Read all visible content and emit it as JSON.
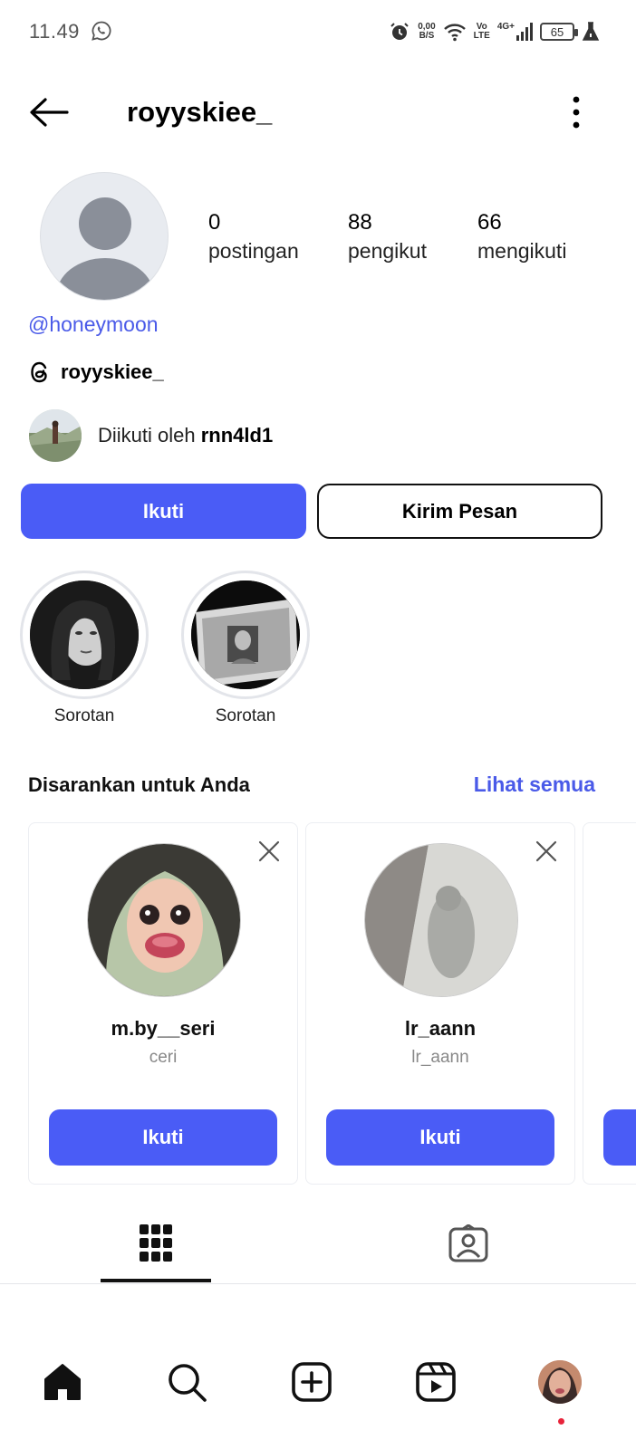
{
  "status_bar": {
    "time": "11.49",
    "net_speed_top": "0,00",
    "net_speed_bottom": "B/S",
    "volte_top": "Vo",
    "volte_bottom": "LTE",
    "network": "4G+",
    "battery": "65"
  },
  "header": {
    "username": "royyskiee_"
  },
  "profile": {
    "stats": [
      {
        "value": "0",
        "label": "postingan"
      },
      {
        "value": "88",
        "label": "pengikut"
      },
      {
        "value": "66",
        "label": "mengikuti"
      }
    ],
    "threads_link": "@honeymoon",
    "threads_name": "royyskiee_",
    "followed_prefix": "Diikuti oleh",
    "followed_by": "rnn4ld1"
  },
  "actions": {
    "follow_label": "Ikuti",
    "message_label": "Kirim Pesan"
  },
  "highlights": [
    {
      "label": "Sorotan"
    },
    {
      "label": "Sorotan"
    }
  ],
  "suggestions": {
    "title": "Disarankan untuk Anda",
    "see_all": "Lihat semua",
    "cards": [
      {
        "username": "m.by__seri",
        "name": "ceri",
        "button": "Ikuti"
      },
      {
        "username": "lr_aann",
        "name": "lr_aann",
        "button": "Ikuti"
      }
    ]
  },
  "colors": {
    "accent": "#4a5cf6",
    "link": "#4a5ae8",
    "notification_dot": "#e8233a"
  },
  "icons": [
    "back-arrow-icon",
    "more-vertical-icon",
    "threads-icon",
    "close-icon",
    "grid-icon",
    "tagged-icon",
    "home-icon",
    "search-icon",
    "create-icon",
    "reels-icon"
  ]
}
